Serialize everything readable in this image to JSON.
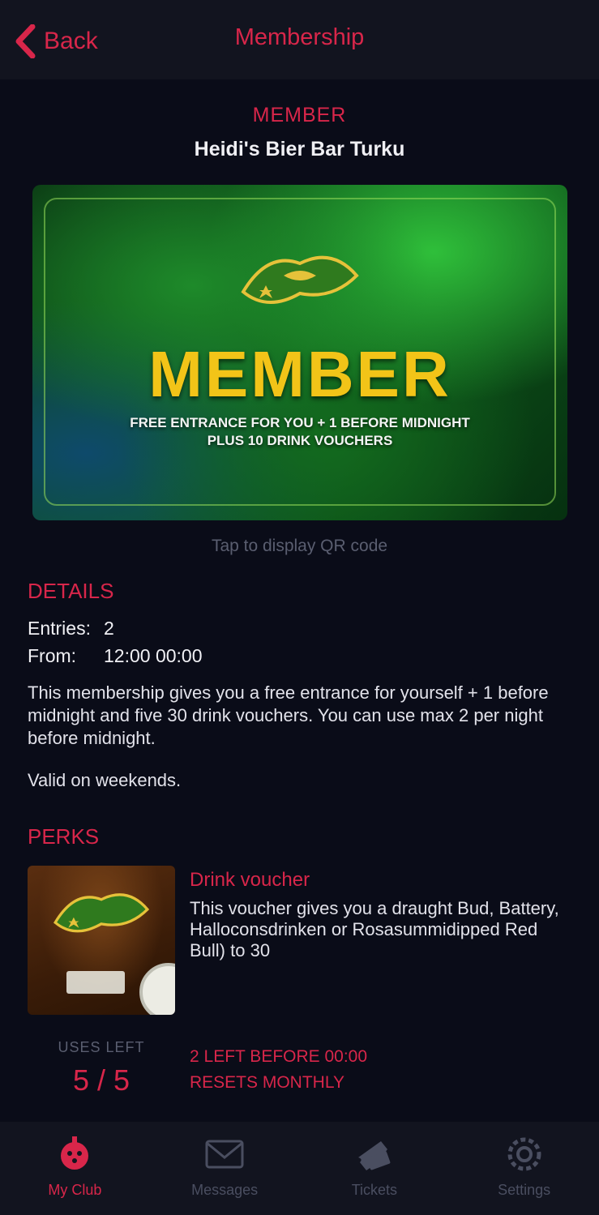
{
  "header": {
    "back_label": "Back",
    "title": "Membership"
  },
  "membership": {
    "badge": "MEMBER",
    "club_name": "Heidi's Bier Bar Turku",
    "card": {
      "headline": "MEMBER",
      "subtext": "FREE ENTRANCE FOR YOU + 1 BEFORE MIDNIGHT\nPLUS 10 DRINK VOUCHERS"
    },
    "tap_hint": "Tap to display QR code"
  },
  "details": {
    "section_title": "DETAILS",
    "entries_label": "Entries:",
    "entries_value": "2",
    "from_label": "From:",
    "from_value": "12:00 00:00",
    "description": "This membership gives you a free entrance for yourself + 1 before midnight and five 30 drink vouchers. You can use max 2 per night before midnight.",
    "note": "Valid on weekends."
  },
  "perks": {
    "section_title": "PERKS",
    "items": [
      {
        "title": "Drink voucher",
        "description": "This voucher gives you a draught Bud, Battery, Halloconsdrinken or Rosasummidipped Red Bull) to 30",
        "uses_left_label": "USES LEFT",
        "uses_left_value": "5 / 5",
        "note_line1": "2 LEFT BEFORE 00:00",
        "note_line2": "RESETS MONTHLY"
      }
    ]
  },
  "tabbar": {
    "items": [
      {
        "label": "My Club",
        "icon": "club-icon",
        "active": true
      },
      {
        "label": "Messages",
        "icon": "messages-icon",
        "active": false
      },
      {
        "label": "Tickets",
        "icon": "tickets-icon",
        "active": false
      },
      {
        "label": "Settings",
        "icon": "settings-icon",
        "active": false
      }
    ]
  },
  "colors": {
    "accent": "#d8264a",
    "background": "#0a0c18",
    "bar": "#12141f",
    "headline_yellow": "#f2c418"
  }
}
